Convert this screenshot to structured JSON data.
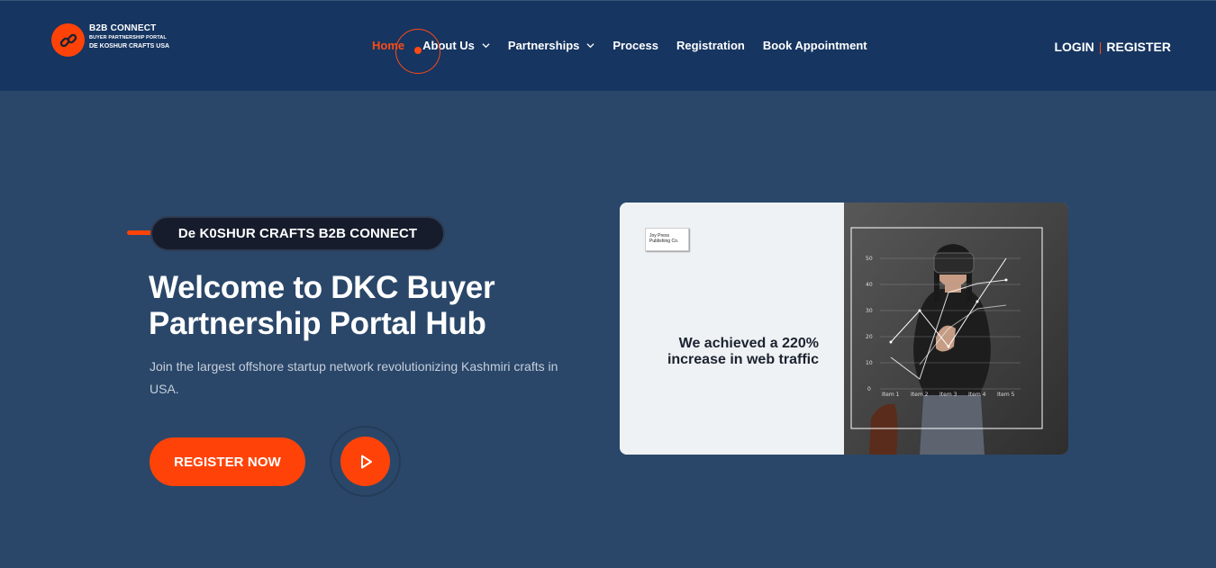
{
  "brand": {
    "title": "B2B CONNECT",
    "subtitle": "BUYER PARTNERSHIP PORTAL",
    "subtitle2": "DE KOSHUR CRAFTS USA"
  },
  "nav": {
    "home": "Home",
    "about": "About Us",
    "partnerships": "Partnerships",
    "process": "Process",
    "registration": "Registration",
    "appointment": "Book Appointment"
  },
  "auth": {
    "login": "LOGIN",
    "separator": "|",
    "register": "REGISTER"
  },
  "hero": {
    "tag": "De K0SHUR CRAFTS B2B CONNECT",
    "title_line1": "Welcome to DKC Buyer",
    "title_line2": "Partnership Portal Hub",
    "subtitle": "Join the largest offshore startup network revolutionizing Kashmiri crafts in USA.",
    "cta": "REGISTER NOW"
  },
  "card": {
    "press_line1": "Joy Press",
    "press_line2": "Publishing Co.",
    "quote_line1": "We achieved a 220%",
    "quote_line2": "increase in web traffic",
    "chart_ticks": [
      "50",
      "40",
      "30",
      "20",
      "10",
      "0"
    ],
    "chart_items": [
      "Item 1",
      "Item 2",
      "Item 3",
      "Item 4",
      "Item 5"
    ]
  },
  "colors": {
    "accent": "#ff4308",
    "header_bg": "#163561",
    "page_bg": "#2a4769"
  }
}
